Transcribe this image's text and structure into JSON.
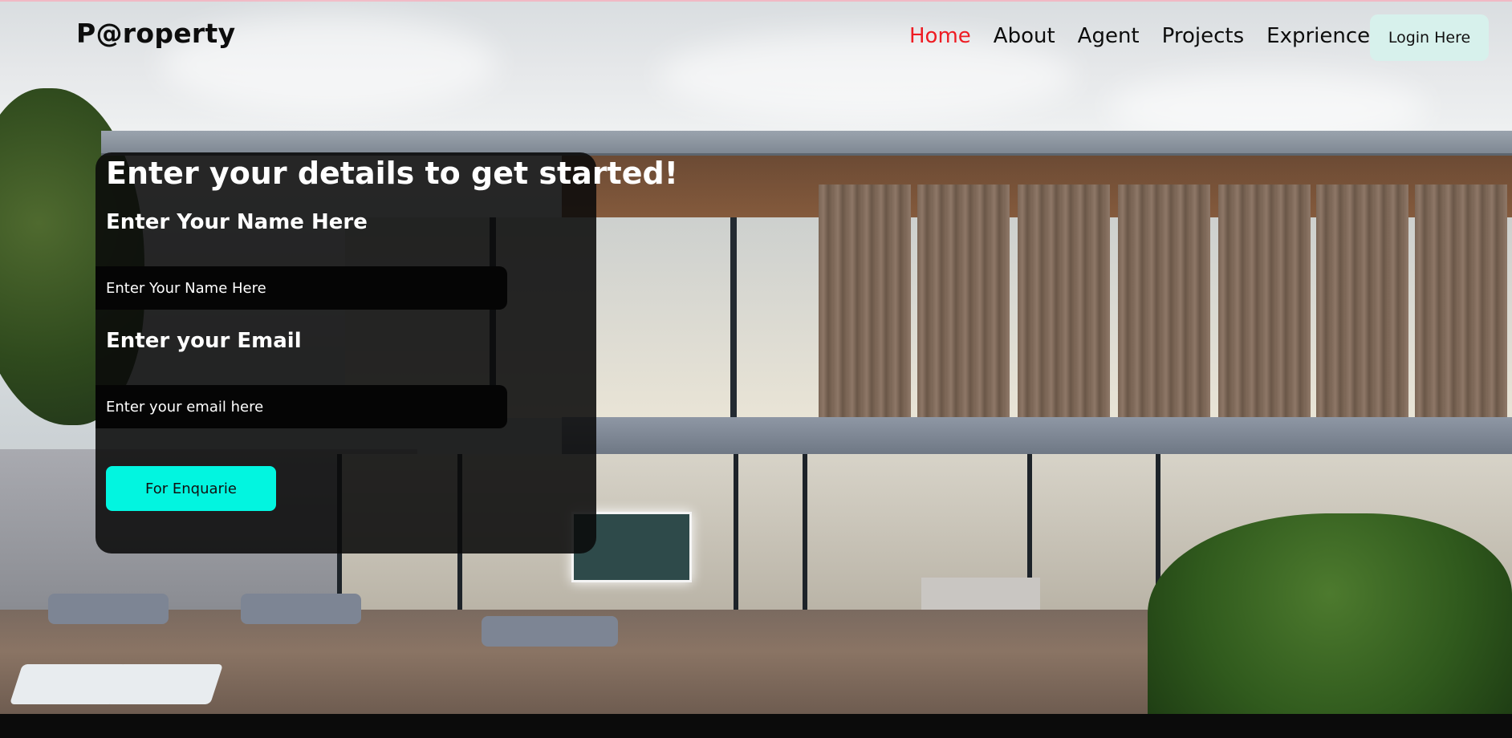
{
  "header": {
    "logo": "P@roperty",
    "nav": [
      "Home",
      "About",
      "Agent",
      "Projects",
      "Exprience"
    ],
    "active_nav": "Home",
    "login_label": "Login Here"
  },
  "form": {
    "heading": "Enter your details to get started!",
    "name_label": "Enter Your Name Here",
    "name_placeholder": "Enter Your Name Here",
    "email_label": "Enter your Email",
    "email_placeholder": "Enter your email here",
    "submit_label": "For Enquarie"
  },
  "colors": {
    "active_nav": "#ee1c23",
    "login_bg": "#d7f1ec",
    "submit_bg": "#02f5e0",
    "card_bg": "rgba(10,10,10,0.88)"
  }
}
